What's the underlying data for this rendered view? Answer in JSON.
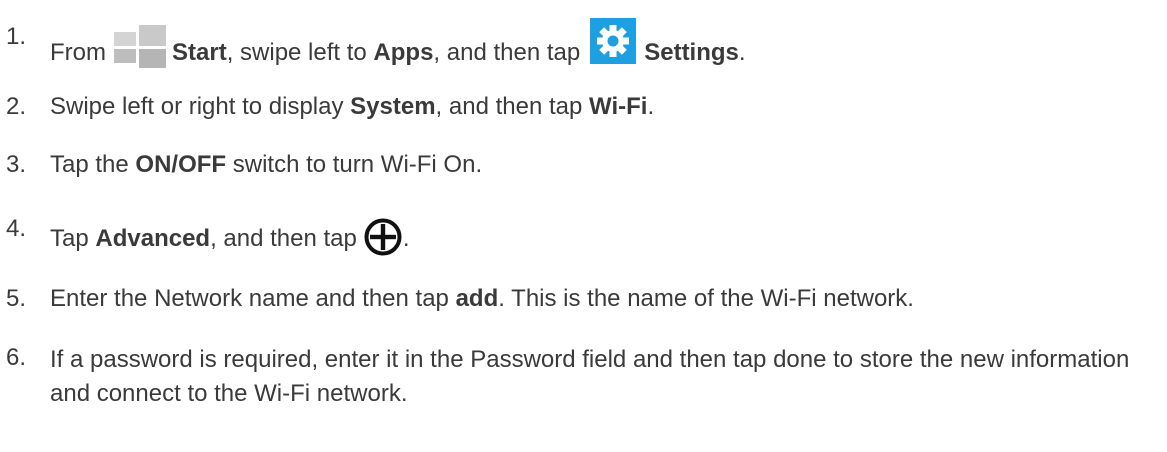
{
  "steps": [
    {
      "number": "1.",
      "parts": [
        "From",
        "Start",
        ", swipe left to",
        "Apps",
        ", and then tap",
        "Settings",
        "."
      ],
      "icons": [
        "windows-start-icon",
        "settings-gear-icon"
      ]
    },
    {
      "number": "2.",
      "parts": [
        "Swipe left or right to display",
        "System",
        ", and then tap",
        "Wi-Fi",
        "."
      ]
    },
    {
      "number": "3.",
      "parts": [
        "Tap the",
        "ON/OFF",
        "switch to turn Wi-Fi On."
      ]
    },
    {
      "number": "4.",
      "parts": [
        "Tap",
        "Advanced",
        ", and then tap",
        "."
      ],
      "icons": [
        "add-circle-icon"
      ]
    },
    {
      "number": "5.",
      "parts": [
        "Enter the Network name and then tap",
        "add",
        ". This is the name of the Wi-Fi network."
      ]
    },
    {
      "number": "6.",
      "text": "If a password is required, enter it in the Password field and then tap done to store the new information and connect to the Wi-Fi network."
    }
  ],
  "colors": {
    "text": "#3a3a3a",
    "start_icon": "#c9c9c9",
    "settings_icon_bg": "#1e9fe0",
    "settings_icon_fg": "#ffffff"
  }
}
